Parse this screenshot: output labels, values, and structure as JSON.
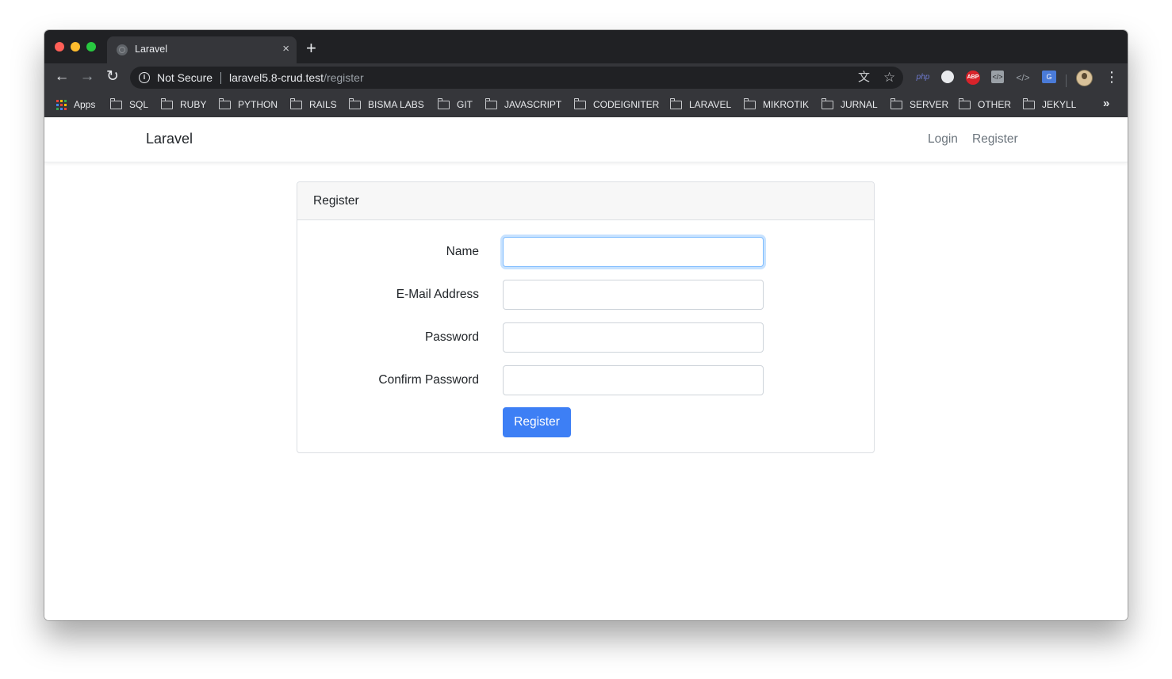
{
  "browser": {
    "tab": {
      "title": "Laravel",
      "close_glyph": "×"
    },
    "new_tab_glyph": "+",
    "toolbar": {
      "back_glyph": "←",
      "forward_glyph": "→",
      "reload_glyph": "↻",
      "security_label": "Not Secure",
      "url_host": "laravel5.8-crud.test",
      "url_path": "/register",
      "translate_glyph": "文",
      "star_glyph": "☆",
      "menu_glyph": "⋮"
    },
    "extensions": {
      "php_label": "php",
      "abp_label": "ABP",
      "code_label": "</>",
      "code2_label": "</>",
      "translate_label": "G"
    },
    "bookmarks": {
      "items": [
        {
          "label": "Apps",
          "icon": "apps-grid-icon"
        },
        {
          "label": "SQL",
          "icon": "folder-icon"
        },
        {
          "label": "RUBY",
          "icon": "folder-icon"
        },
        {
          "label": "PYTHON",
          "icon": "folder-icon"
        },
        {
          "label": "RAILS",
          "icon": "folder-icon"
        },
        {
          "label": "BISMA LABS",
          "icon": "folder-icon"
        },
        {
          "label": "GIT",
          "icon": "folder-icon"
        },
        {
          "label": "JAVASCRIPT",
          "icon": "folder-icon"
        },
        {
          "label": "CODEIGNITER",
          "icon": "folder-icon"
        },
        {
          "label": "LARAVEL",
          "icon": "folder-icon"
        },
        {
          "label": "MIKROTIK",
          "icon": "folder-icon"
        },
        {
          "label": "JURNAL",
          "icon": "folder-icon"
        },
        {
          "label": "SERVER",
          "icon": "folder-icon"
        },
        {
          "label": "OTHER",
          "icon": "folder-icon"
        },
        {
          "label": "JEKYLL",
          "icon": "folder-icon"
        }
      ],
      "more_glyph": "»"
    }
  },
  "site": {
    "brand": "Laravel",
    "nav": {
      "login": "Login",
      "register": "Register"
    }
  },
  "form": {
    "header": "Register",
    "fields": {
      "name": {
        "label": "Name",
        "value": ""
      },
      "email": {
        "label": "E-Mail Address",
        "value": ""
      },
      "password": {
        "label": "Password",
        "value": ""
      },
      "confirm_password": {
        "label": "Confirm Password",
        "value": ""
      }
    },
    "submit_label": "Register"
  },
  "colors": {
    "primary_button": "#3d7ff5",
    "focus_ring": "#80bdff",
    "chrome_dark": "#202124",
    "chrome_toolbar": "#35363a"
  }
}
